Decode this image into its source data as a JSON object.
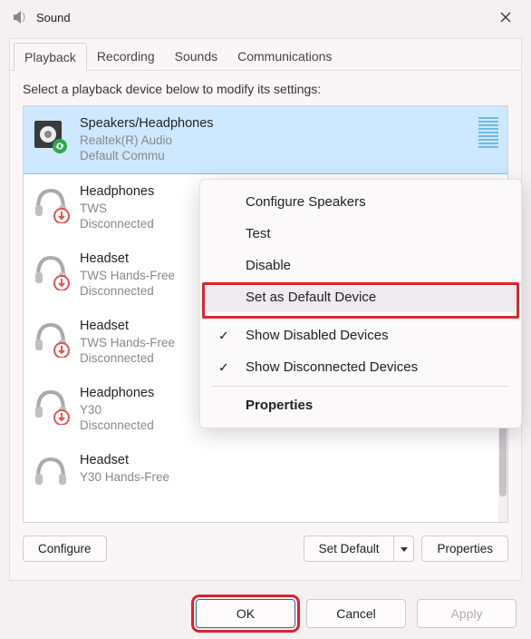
{
  "window": {
    "title": "Sound"
  },
  "tabs": [
    "Playback",
    "Recording",
    "Sounds",
    "Communications"
  ],
  "active_tab": 0,
  "instruction": "Select a playback device below to modify its settings:",
  "devices": [
    {
      "name": "Speakers/Headphones",
      "sub1": "Realtek(R) Audio",
      "sub2": "Default Commu",
      "selected": true,
      "kind": "speaker"
    },
    {
      "name": "Headphones",
      "sub1": "TWS",
      "sub2": "Disconnected",
      "selected": false,
      "kind": "headphone"
    },
    {
      "name": "Headset",
      "sub1": "TWS Hands-Free",
      "sub2": "Disconnected",
      "selected": false,
      "kind": "headphone"
    },
    {
      "name": "Headset",
      "sub1": "TWS Hands-Free",
      "sub2": "Disconnected",
      "selected": false,
      "kind": "headphone"
    },
    {
      "name": "Headphones",
      "sub1": "Y30",
      "sub2": "Disconnected",
      "selected": false,
      "kind": "headphone"
    },
    {
      "name": "Headset",
      "sub1": "Y30 Hands-Free",
      "sub2": "",
      "selected": false,
      "kind": "headphone"
    }
  ],
  "context_menu": {
    "items": [
      {
        "label": "Configure Speakers",
        "checked": false,
        "bold": false
      },
      {
        "label": "Test",
        "checked": false,
        "bold": false
      },
      {
        "label": "Disable",
        "checked": false,
        "bold": false
      },
      {
        "label": "Set as Default Device",
        "checked": false,
        "bold": false,
        "highlighted": true
      },
      {
        "separator": true
      },
      {
        "label": "Show Disabled Devices",
        "checked": true,
        "bold": false
      },
      {
        "label": "Show Disconnected Devices",
        "checked": true,
        "bold": false
      },
      {
        "separator": true
      },
      {
        "label": "Properties",
        "checked": false,
        "bold": true
      }
    ]
  },
  "buttons": {
    "configure": "Configure",
    "set_default": "Set Default",
    "properties": "Properties",
    "ok": "OK",
    "cancel": "Cancel",
    "apply": "Apply"
  }
}
